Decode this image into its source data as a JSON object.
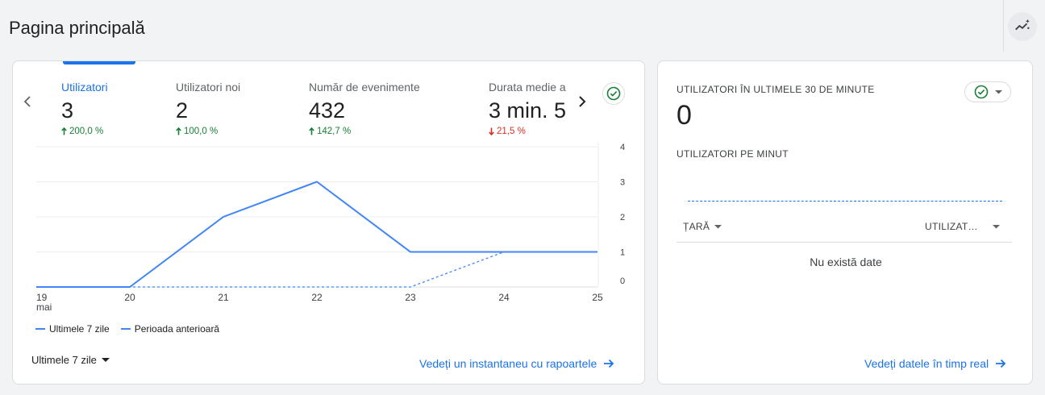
{
  "page": {
    "title": "Pagina principală"
  },
  "main_card": {
    "metrics": [
      {
        "label": "Utilizatori",
        "value": "3",
        "change": "200,0 %",
        "direction": "up"
      },
      {
        "label": "Utilizatori noi",
        "value": "2",
        "change": "100,0 %",
        "direction": "up"
      },
      {
        "label": "Număr de evenimente",
        "value": "432",
        "change": "142,7 %",
        "direction": "up"
      },
      {
        "label": "Durata medie a",
        "value": "3 min. 5",
        "change": "21,5 %",
        "direction": "down"
      }
    ],
    "legend": {
      "current": "Ultimele 7 zile",
      "previous": "Perioada anterioară"
    },
    "range_label": "Ultimele 7 zile",
    "link_label": "Vedeți un instantaneu cu rapoartele"
  },
  "chart_data": {
    "type": "line",
    "x": [
      "19",
      "20",
      "21",
      "22",
      "23",
      "24",
      "25"
    ],
    "x_sublabel_first": "mai",
    "y_ticks": [
      "4",
      "3",
      "2",
      "1",
      "0"
    ],
    "ylim": [
      0,
      4
    ],
    "series": [
      {
        "name": "Ultimele 7 zile",
        "style": "solid",
        "values": [
          0,
          0,
          2,
          3,
          1,
          1,
          1
        ]
      },
      {
        "name": "Perioada anterioară",
        "style": "dashed",
        "values": [
          0,
          0,
          0,
          0,
          0,
          1,
          1
        ]
      }
    ],
    "color": "#4285f4",
    "grid": true,
    "legend_position": "bottom-left"
  },
  "realtime_card": {
    "title": "UTILIZATORI ÎN ULTIMELE 30 DE MINUTE",
    "value": "0",
    "subtitle": "UTILIZATORI PE MINUT",
    "col_country": "ȚARĂ",
    "col_users": "UTILIZAT…",
    "no_data": "Nu există date",
    "link_label": "Vedeți datele în timp real"
  },
  "colors": {
    "accent": "#1a73e8",
    "up": "#188038",
    "down": "#d93025",
    "status_ok": "#188038"
  },
  "icons": [
    "chevron-left-icon",
    "chevron-right-icon",
    "check-circle-icon",
    "insights-icon",
    "arrow-right-icon",
    "dropdown-arrow-icon"
  ]
}
